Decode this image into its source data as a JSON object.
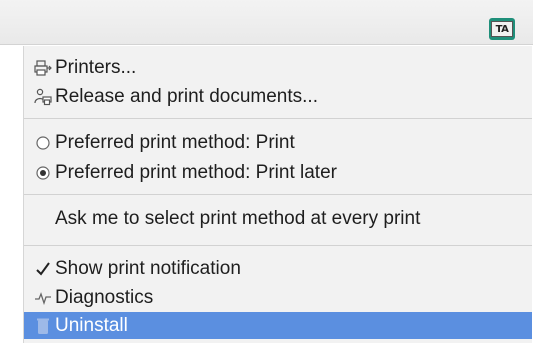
{
  "menubar": {
    "tray_icon_text": "TA"
  },
  "menu": {
    "printers": {
      "label": "Printers...",
      "icon": "printer-icon"
    },
    "release": {
      "label": "Release and print documents...",
      "icon": "release-print-icon"
    },
    "method_print": {
      "label": "Preferred print method: Print",
      "icon": "radio-empty-icon",
      "checked": false
    },
    "method_print_later": {
      "label": "Preferred print method: Print later",
      "icon": "radio-selected-icon",
      "checked": true
    },
    "ask_method": {
      "label": "Ask me to select print method at every print"
    },
    "notification": {
      "label": "Show print notification",
      "icon": "checkmark-icon",
      "checked": true
    },
    "diagnostics": {
      "label": "Diagnostics",
      "icon": "pulse-icon"
    },
    "uninstall": {
      "label": "Uninstall",
      "icon": "trash-icon",
      "highlighted": true
    }
  },
  "colors": {
    "highlight": "#5b8fe0",
    "tray_icon": "#1f8f7a",
    "menu_bg": "#f2f2f2"
  }
}
